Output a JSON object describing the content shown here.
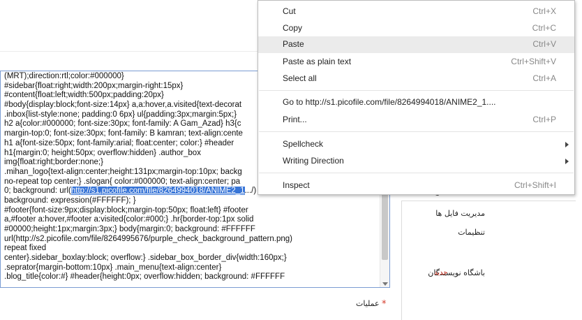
{
  "editor": {
    "lines": [
      {
        "pre": "(MRT);direction:rtl;color:#000000}",
        "sel": "",
        "post": ""
      },
      {
        "pre": "#sidebar{float:right;width:200px;margin-right:15px}",
        "sel": "",
        "post": ""
      },
      {
        "pre": "#content{float:left;width:500px;padding:20px}",
        "sel": "",
        "post": ""
      },
      {
        "pre": "#body{display:block;font-size:14px} a,a:hover,a.visited{text-decorat",
        "sel": "",
        "post": ""
      },
      {
        "pre": ".inbox{list-style:none; padding:0 6px} ul{padding:3px;margin:5px;}",
        "sel": "",
        "post": ""
      },
      {
        "pre": "h2 a{color:#000000; font-size:30px; font-family: A Gam_Azad} h3{c",
        "sel": "",
        "post": ""
      },
      {
        "pre": "margin-top:0; font-size:30px; font-family: B kamran; text-align:cente",
        "sel": "",
        "post": ""
      },
      {
        "pre": "h1 a{font-size:50px; font-family:arial; float:center; color:} #header",
        "sel": "",
        "post": ""
      },
      {
        "pre": "h1{margin:0; height:50px; overflow:hidden} .author_box",
        "sel": "",
        "post": ""
      },
      {
        "pre": "img{float:right;border:none;}",
        "sel": "",
        "post": ""
      },
      {
        "pre": ".mihan_logo{text-align:center;height:131px;margin-top:10px; backg",
        "sel": "",
        "post": ""
      },
      {
        "pre": "no-repeat top center;} .slogan{ color:#000000; text-align:center; pa",
        "sel": "",
        "post": ""
      },
      {
        "pre": "0; background: url(",
        "sel": "http://s1.picofile.com/file/8264994018/ANIME2_1",
        "post": ".../) repeat;"
      },
      {
        "pre": "background: expression(#FFFFFF); }",
        "sel": "",
        "post": ""
      },
      {
        "pre": "#footer{font-size:9px;display:block;margin-top:50px; float:left} #footer",
        "sel": "",
        "post": ""
      },
      {
        "pre": "a,#footer a:hover,#footer a:visited{color:#000;} .hr{border-top:1px solid",
        "sel": "",
        "post": ""
      },
      {
        "pre": "#00000;height:1px;margin:3px;} body{margin:0; background: #FFFFFF",
        "sel": "",
        "post": ""
      },
      {
        "pre": "url(http://s2.picofile.com/file/8264995676/purple_check_background_pattern.png)",
        "sel": "",
        "post": ""
      },
      {
        "pre": "repeat fixed",
        "sel": "",
        "post": ""
      },
      {
        "pre": "center}.sidebar_boxlay:block; overflow:} .sidebar_box_border_div{width:160px;}",
        "sel": "",
        "post": ""
      },
      {
        "pre": ".seprator{margin-bottom:10px} .main_menu{text-align:center}",
        "sel": "",
        "post": ""
      },
      {
        "pre": ".blog_title{color:#} #header{height:0px; overflow:hidden; background: #FFFFFF",
        "sel": "",
        "post": ""
      }
    ]
  },
  "context_menu": {
    "items": [
      {
        "label": "Cut",
        "shortcut": "Ctrl+X"
      },
      {
        "label": "Copy",
        "shortcut": "Ctrl+C"
      },
      {
        "label": "Paste",
        "shortcut": "Ctrl+V"
      },
      {
        "label": "Paste as plain text",
        "shortcut": "Ctrl+Shift+V"
      },
      {
        "label": "Select all",
        "shortcut": "Ctrl+A"
      },
      {
        "label": "Go to http://s1.picofile.com/file/8264994018/ANIME2_1....",
        "shortcut": ""
      },
      {
        "label": "Print...",
        "shortcut": "Ctrl+P"
      },
      {
        "label": "Spellcheck",
        "shortcut": ""
      },
      {
        "label": "Writing Direction",
        "shortcut": ""
      },
      {
        "label": "Inspect",
        "shortcut": "Ctrl+Shift+I"
      }
    ]
  },
  "right_panel": {
    "tab": "ان",
    "items": [
      {
        "label": "مدیریت فایل ها"
      },
      {
        "label": "تنظیمات"
      },
      {
        "label": "باشگاه نویسندگان",
        "badge": "جدید"
      }
    ]
  },
  "form": {
    "operations_label": "عملیات",
    "required_mark": "*",
    "bottom_text": "ـ ـ ـ ـ ـ ـ ـ ـ ـ ـ ـ ـ ـ"
  }
}
